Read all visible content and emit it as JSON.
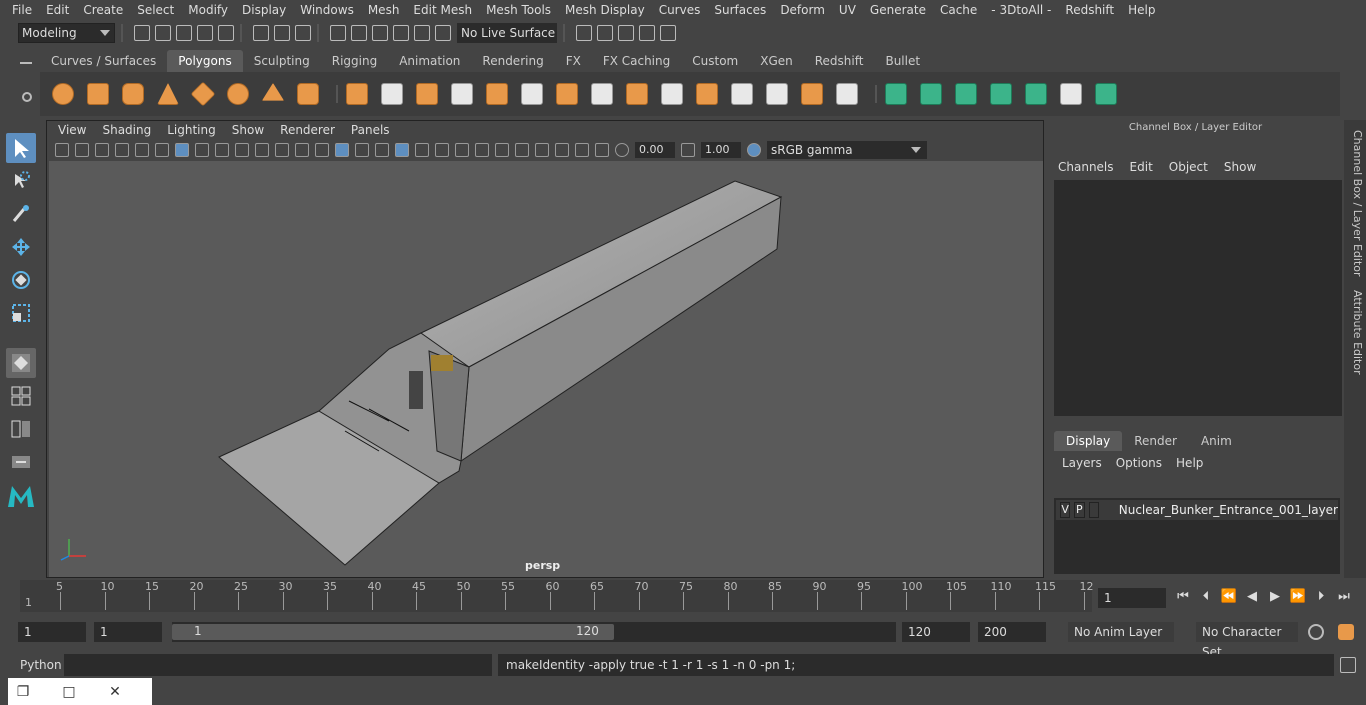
{
  "menubar": {
    "items": [
      "File",
      "Edit",
      "Create",
      "Select",
      "Modify",
      "Display",
      "Windows",
      "Mesh",
      "Edit Mesh",
      "Mesh Tools",
      "Mesh Display",
      "Curves",
      "Surfaces",
      "Deform",
      "UV",
      "Generate",
      "Cache",
      "- 3DtoAll -",
      "Redshift",
      "Help"
    ]
  },
  "status": {
    "mode": "Modeling",
    "live_surface": "No Live Surface"
  },
  "shelf": {
    "tabs": [
      "Curves / Surfaces",
      "Polygons",
      "Sculpting",
      "Rigging",
      "Animation",
      "Rendering",
      "FX",
      "FX Caching",
      "Custom",
      "XGen",
      "Redshift",
      "Bullet"
    ],
    "active_tab": "Polygons"
  },
  "viewport": {
    "menu": [
      "View",
      "Shading",
      "Lighting",
      "Show",
      "Renderer",
      "Panels"
    ],
    "exposure": "0.00",
    "gamma": "1.00",
    "color_space": "sRGB gamma",
    "camera": "persp"
  },
  "channelbox": {
    "title": "Channel Box / Layer Editor",
    "menu": [
      "Channels",
      "Edit",
      "Object",
      "Show"
    ],
    "layer_tabs": [
      "Display",
      "Render",
      "Anim"
    ],
    "active_layer_tab": "Display",
    "layer_menu": [
      "Layers",
      "Options",
      "Help"
    ],
    "layer": {
      "v": "V",
      "p": "P",
      "name": "Nuclear_Bunker_Entrance_001_layer"
    }
  },
  "sidetabs": {
    "channel": "Channel Box / Layer Editor",
    "attribute": "Attribute Editor"
  },
  "timeline": {
    "ticks": [
      "5",
      "10",
      "15",
      "20",
      "25",
      "30",
      "35",
      "40",
      "45",
      "50",
      "55",
      "60",
      "65",
      "70",
      "75",
      "80",
      "85",
      "90",
      "95",
      "100",
      "105",
      "110",
      "115",
      "12"
    ],
    "start_label": "1",
    "current_frame": "1"
  },
  "range": {
    "start": "1",
    "start2": "1",
    "slider_start": "1",
    "slider_end": "120",
    "end": "120",
    "end2": "200",
    "anim_layer": "No Anim Layer",
    "char_set": "No Character Set"
  },
  "cmd": {
    "label": "Python",
    "output": "makeIdentity -apply true -t 1 -r 1 -s 1 -n 0 -pn 1;"
  }
}
